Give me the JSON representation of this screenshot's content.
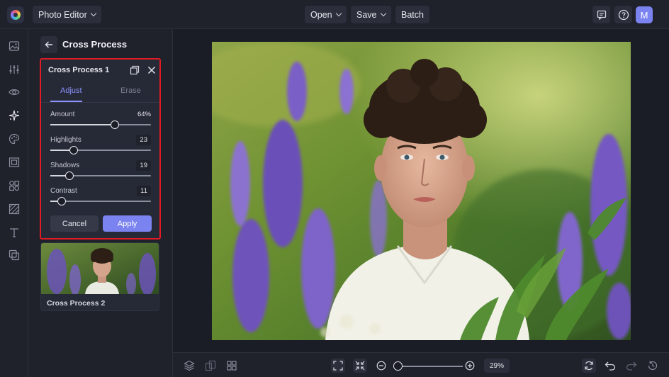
{
  "header": {
    "app_menu_label": "Photo Editor",
    "open_label": "Open",
    "save_label": "Save",
    "batch_label": "Batch",
    "avatar_initial": "M"
  },
  "rail": {
    "items": [
      "image-icon",
      "sliders-icon",
      "eye-icon",
      "sparkle-effects-icon",
      "palette-icon",
      "frame-icon",
      "shapes-icon",
      "texture-icon",
      "text-icon",
      "layers-overlay-icon"
    ],
    "active_item": "sparkle-effects-icon"
  },
  "panel": {
    "title": "Cross Process",
    "effect_card": {
      "title": "Cross Process 1",
      "tabs": [
        {
          "label": "Adjust",
          "active": true
        },
        {
          "label": "Erase",
          "active": false
        }
      ],
      "sliders": [
        {
          "label": "Amount",
          "value": "64%",
          "level": 0.64
        },
        {
          "label": "Highlights",
          "value": "23",
          "level": 0.23
        },
        {
          "label": "Shadows",
          "value": "19",
          "level": 0.19
        },
        {
          "label": "Contrast",
          "value": "11",
          "level": 0.11
        }
      ],
      "cancel_label": "Cancel",
      "apply_label": "Apply"
    },
    "preset_card": {
      "label": "Cross Process 2"
    }
  },
  "canvas": {
    "zoom_value": "29%",
    "zoom_level": 0.05
  },
  "colors": {
    "accent": "#7b83f0",
    "highlight_border": "#e01b24",
    "background": "#1b1d26",
    "panel": "#1f212b"
  }
}
